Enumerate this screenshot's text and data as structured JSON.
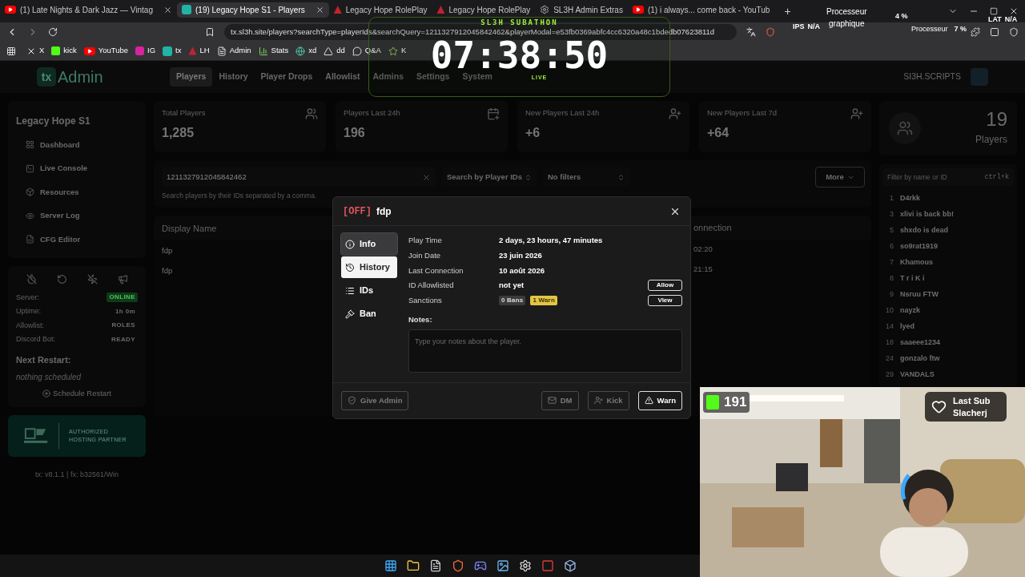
{
  "browser": {
    "tabs": [
      {
        "title": "(1) Late Nights & Dark Jazz — Vintag",
        "kind": "youtube",
        "selected": false,
        "close": true
      },
      {
        "title": "(19) Legacy Hope S1 - Players",
        "kind": "tx",
        "selected": true,
        "close": true
      },
      {
        "title": "Legacy Hope RolePlay",
        "kind": "lh",
        "selected": false,
        "close": false
      },
      {
        "title": "Legacy Hope RolePlay",
        "kind": "lh",
        "selected": false,
        "close": false
      },
      {
        "title": "SL3H Admin Extras",
        "kind": "gear",
        "selected": false,
        "close": false
      },
      {
        "title": "(1) i always... come back - YouTub",
        "kind": "youtube",
        "selected": false,
        "close": false
      }
    ],
    "new_tab": "+",
    "url": "tx.sl3h.site/players?searchType=playerIds&searchQuery=1211327912045842462&playerModal=e53fb0369abfc4cc6320a48c1bdedb07623811d",
    "bookmarks": [
      {
        "label": "X",
        "kind": "x"
      },
      {
        "label": "kick",
        "kind": "kick"
      },
      {
        "label": "YouTube",
        "kind": "youtube"
      },
      {
        "label": "IG",
        "kind": "ig"
      },
      {
        "label": "tx",
        "kind": "tx"
      },
      {
        "label": "LH",
        "kind": "lh"
      },
      {
        "label": "Admin",
        "kind": "doc"
      },
      {
        "label": "Stats",
        "kind": "stats"
      },
      {
        "label": "xd",
        "kind": "globe"
      },
      {
        "label": "dd",
        "kind": "lambda"
      },
      {
        "label": "Q&A",
        "kind": "qa"
      },
      {
        "label": "K",
        "kind": "star"
      }
    ]
  },
  "stream_overlay": {
    "timer_title": "SL3H SUBATHON",
    "timer": "07:38:50",
    "live": "LIVE",
    "cpu_label": "Processeur",
    "cpu_value": "4 %",
    "ips_label": "IPS",
    "ips_value": "N/A",
    "gpu_label": "graphique",
    "gpu_cpu_label": "Processeur",
    "gpu_value": "7 %",
    "lat_label": "LAT",
    "lat_value": "N/A",
    "viewer_count": "191",
    "last_sub_label": "Last Sub",
    "last_sub_name": "Slacherj"
  },
  "app": {
    "logo_mark": "tx",
    "logo_text": "Admin",
    "nav": [
      {
        "label": "Players",
        "selected": true
      },
      {
        "label": "History",
        "selected": false
      },
      {
        "label": "Player Drops",
        "selected": false
      },
      {
        "label": "Allowlist",
        "selected": false
      },
      {
        "label": "Admins",
        "selected": false
      },
      {
        "label": "Settings",
        "selected": false
      },
      {
        "label": "System",
        "selected": false
      }
    ],
    "user": "SI3H.SCRIPTS",
    "server_name": "Legacy Hope S1",
    "menu": [
      {
        "label": "Dashboard",
        "kind": "grid"
      },
      {
        "label": "Live Console",
        "kind": "console"
      },
      {
        "label": "Resources",
        "kind": "box"
      },
      {
        "label": "Server Log",
        "kind": "eye"
      },
      {
        "label": "CFG Editor",
        "kind": "file"
      }
    ],
    "status": [
      {
        "label": "Server:",
        "value": "ONLINE",
        "kind": "badge"
      },
      {
        "label": "Uptime:",
        "value": "1h 0m",
        "kind": "text"
      },
      {
        "label": "Allowlist:",
        "value": "ROLES",
        "kind": "text"
      },
      {
        "label": "Discord Bot:",
        "value": "READY",
        "kind": "text"
      }
    ],
    "next_restart_title": "Next Restart:",
    "next_restart_value": "nothing scheduled",
    "schedule_button": "Schedule Restart",
    "partner_text": "AUTHORIZED HOSTING PARTNER",
    "version": "tx: v8.1.1 | fx: b32561/Win",
    "stats": [
      {
        "label": "Total Players",
        "value": "1,285",
        "kind": "users"
      },
      {
        "label": "Players Last 24h",
        "value": "196",
        "kind": "calendar"
      },
      {
        "label": "New Players Last 24h",
        "value": "+6",
        "kind": "userplus"
      },
      {
        "label": "New Players Last 7d",
        "value": "+64",
        "kind": "userplus"
      }
    ],
    "search": {
      "value": "1211327912045842462",
      "hint": "Search players by their IDs separated by a comma.",
      "search_type": "Search by Player IDs",
      "filters": "No filters",
      "more": "More"
    },
    "table": {
      "columns": [
        "Display Name",
        "onnection"
      ],
      "rows": [
        [
          "fdp",
          "02:20"
        ],
        [
          "fdp",
          "21:15"
        ]
      ]
    },
    "online": {
      "count": "19",
      "label": "Players",
      "filter_placeholder": "Filter by name or ID",
      "shortcut": "ctrl+k",
      "players": [
        {
          "num": "1",
          "name": "D4rkk"
        },
        {
          "num": "3",
          "name": "xlivi is back bb!"
        },
        {
          "num": "5",
          "name": "shxdo is dead"
        },
        {
          "num": "6",
          "name": "so9rat1919"
        },
        {
          "num": "7",
          "name": "Khamous"
        },
        {
          "num": "8",
          "name": "T r i K i"
        },
        {
          "num": "9",
          "name": "Nsruu FTW"
        },
        {
          "num": "10",
          "name": "nayzk"
        },
        {
          "num": "14",
          "name": "lyed"
        },
        {
          "num": "18",
          "name": "saaeee1234"
        },
        {
          "num": "24",
          "name": "gonzalo ftw"
        },
        {
          "num": "29",
          "name": "VANDALS"
        }
      ]
    },
    "modal": {
      "status": "[OFF]",
      "name": "fdp",
      "tabs": [
        {
          "label": "Info",
          "kind": "info",
          "selected": true,
          "hovered": false
        },
        {
          "label": "History",
          "kind": "history",
          "selected": false,
          "hovered": true
        },
        {
          "label": "IDs",
          "kind": "list",
          "selected": false,
          "hovered": false
        },
        {
          "label": "Ban",
          "kind": "gavel",
          "selected": false,
          "hovered": false
        }
      ],
      "rows": [
        {
          "label": "Play Time",
          "value": "2 days, 23 hours, 47 minutes"
        },
        {
          "label": "Join Date",
          "value": "23 juin 2026"
        },
        {
          "label": "Last Connection",
          "value": "10 août 2026"
        },
        {
          "label": "ID Allowlisted",
          "value": "not yet",
          "action": "Allow"
        },
        {
          "label": "Sanctions",
          "badges": [
            {
              "text": "0 Bans",
              "color": "#3b3b3d"
            },
            {
              "text": "1 Warn",
              "color": "#e3c545"
            }
          ],
          "action": "View"
        }
      ],
      "notes_label": "Notes:",
      "notes_placeholder": "Type your notes about the player.",
      "buttons": [
        {
          "label": "Give Admin",
          "kind": "shield",
          "disabled": true
        },
        {
          "label": "DM",
          "kind": "mail",
          "disabled": true
        },
        {
          "label": "Kick",
          "kind": "kick",
          "disabled": true
        },
        {
          "label": "Warn",
          "kind": "warn",
          "disabled": false
        }
      ]
    }
  }
}
